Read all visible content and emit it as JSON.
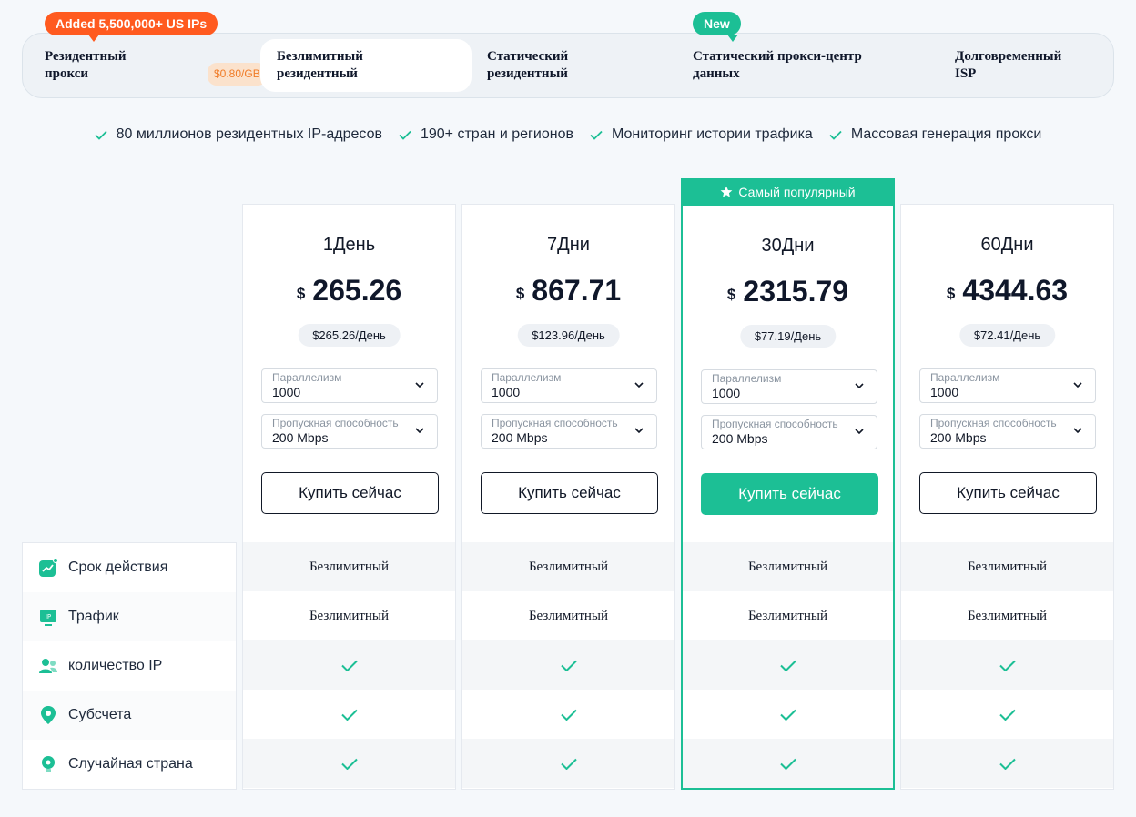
{
  "tabs": [
    {
      "label_line1": "Резидентный",
      "label_line2": "прокси",
      "price_badge": "$0.80/GB"
    },
    {
      "label_line1": "Безлимитный",
      "label_line2": "резидентный"
    },
    {
      "label_line1": "Статический",
      "label_line2": "резидентный"
    },
    {
      "label_line1": "Статический прокси-центр",
      "label_line2": "данных"
    },
    {
      "label_line1": "Долговременный",
      "label_line2": "ISP"
    }
  ],
  "promo_bubble": "Added 5,500,000+ US IPs",
  "new_bubble": "New",
  "features": [
    "80 миллионов резидентных IP-адресов",
    "190+ стран и регионов",
    "Мониторинг истории трафика",
    "Массовая генерация прокси"
  ],
  "popular_label": "Самый популярный",
  "currency": "$",
  "plans": [
    {
      "name": "1День",
      "price": "265.26",
      "per_day": "$265.26/День"
    },
    {
      "name": "7Дни",
      "price": "867.71",
      "per_day": "$123.96/День"
    },
    {
      "name": "30Дни",
      "price": "2315.79",
      "per_day": "$77.19/День"
    },
    {
      "name": "60Дни",
      "price": "4344.63",
      "per_day": "$72.41/День"
    }
  ],
  "concurrency": {
    "caption": "Параллелизм",
    "value": "1000"
  },
  "bandwidth": {
    "caption": "Пропускная способность",
    "value": "200 Mbps"
  },
  "buy_label": "Купить сейчас",
  "rows": [
    {
      "label": "Срок действия",
      "icon": "chart-icon",
      "value": "Безлимитный"
    },
    {
      "label": "Трафик",
      "icon": "ip-icon",
      "value": "Безлимитный"
    },
    {
      "label": "количество IP",
      "icon": "users-icon",
      "value": "check"
    },
    {
      "label": "Субсчета",
      "icon": "location-icon",
      "value": "check"
    },
    {
      "label": "Случайная страна",
      "icon": "bulb-icon",
      "value": "check"
    }
  ],
  "colors": {
    "accent": "#1cbf95",
    "promo": "#ff5a1f",
    "price_badge_bg": "#fbe2cc"
  }
}
